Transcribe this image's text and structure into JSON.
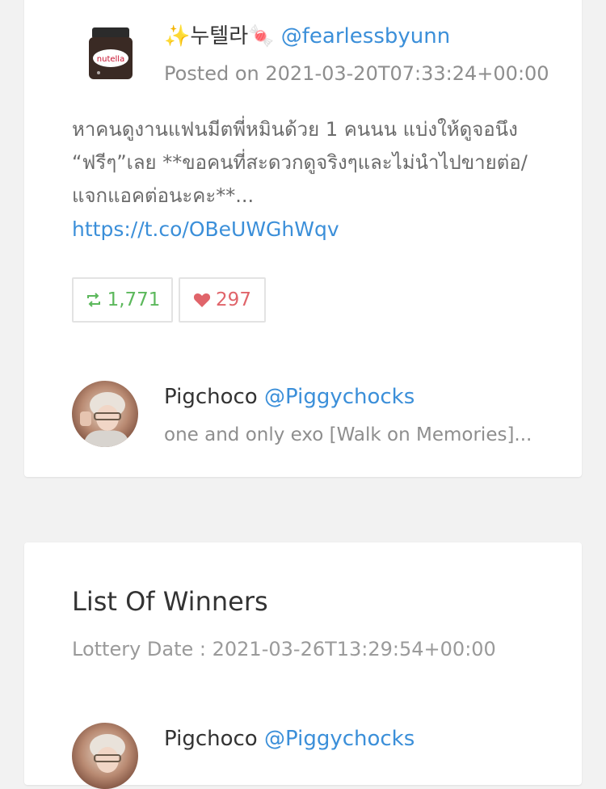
{
  "tweet_card": {
    "author": {
      "display_name": "✨누텔라🍬",
      "handle": "@fearlessbyunn",
      "avatar_icon": "nutella-jar-icon",
      "avatar_label": "nutella"
    },
    "posted_on": "Posted on 2021-03-20T07:33:24+00:00",
    "text": "หาคนดูงานแฟนมีตพี่หมินด้วย 1 คนนน แบ่งให้ดูจอนึง “ฟรีๆ”เลย **ขอคนที่สะดวกดูจริงๆและไม่นำไปขายต่อ/แจกแอคต่อนะคะ**...",
    "link": "https://t.co/OBeUWGhWqv",
    "retweets": "1,771",
    "likes": "297",
    "retweet_color": "#5cb85c",
    "like_color": "#e0646a",
    "participant": {
      "display_name": "Pigchoco",
      "handle": "@Piggychocks",
      "bio": "one and only exo [Walk on Memories]...",
      "avatar_icon": "profile-photo-avatar"
    }
  },
  "winners_card": {
    "title": "List Of Winners",
    "lottery_date": "Lottery Date : 2021-03-26T13:29:54+00:00",
    "winners": [
      {
        "display_name": "Pigchoco",
        "handle": "@Piggychocks",
        "avatar_icon": "profile-photo-avatar"
      }
    ]
  },
  "colors": {
    "link": "#3b8fd9",
    "background": "#f2f2f2",
    "card": "#ffffff",
    "muted_text": "#8e8e8e"
  }
}
